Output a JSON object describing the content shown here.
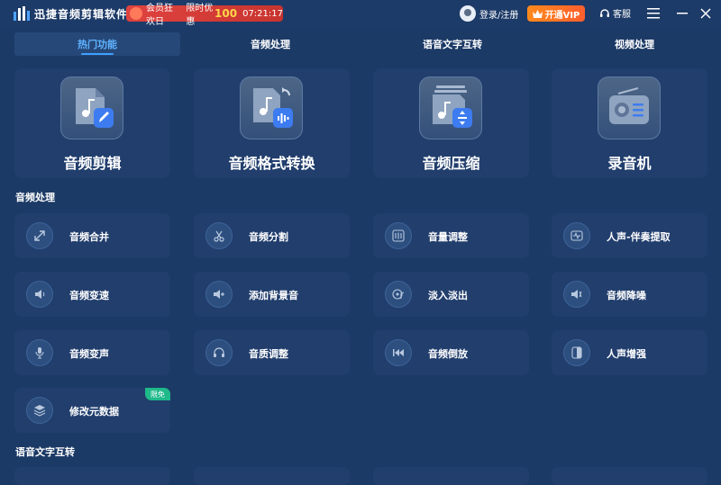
{
  "titlebar": {
    "app_name": "迅捷音频剪辑软件",
    "promo": {
      "tag": "会员狂欢日",
      "offer": "限时优惠",
      "number": "100",
      "countdown": "07:21:17"
    },
    "login_label": "登录/注册",
    "vip_label": "开通VIP",
    "service_label": "客服"
  },
  "tabs": [
    {
      "label": "热门功能",
      "active": true
    },
    {
      "label": "音频处理"
    },
    {
      "label": "语音文字互转"
    },
    {
      "label": "视频处理"
    }
  ],
  "features": [
    {
      "label": "音频剪辑",
      "icon": "music-edit-icon"
    },
    {
      "label": "音频格式转换",
      "icon": "music-convert-icon"
    },
    {
      "label": "音频压缩",
      "icon": "music-compress-icon"
    },
    {
      "label": "录音机",
      "icon": "radio-recorder-icon"
    }
  ],
  "sections": {
    "audio": "音频处理",
    "speech": "语音文字互转"
  },
  "items": [
    {
      "label": "音频合并",
      "icon": "merge-icon"
    },
    {
      "label": "音频分割",
      "icon": "scissors-icon"
    },
    {
      "label": "音量调整",
      "icon": "volume-adjust-icon"
    },
    {
      "label": "人声-伴奏提取",
      "icon": "waveform-icon"
    },
    {
      "label": "音频变速",
      "icon": "speed-icon"
    },
    {
      "label": "添加背景音",
      "icon": "add-background-icon"
    },
    {
      "label": "淡入淡出",
      "icon": "fade-icon"
    },
    {
      "label": "音频降噪",
      "icon": "denoise-icon"
    },
    {
      "label": "音频变声",
      "icon": "microphone-icon"
    },
    {
      "label": "音质调整",
      "icon": "headphones-icon"
    },
    {
      "label": "音频倒放",
      "icon": "rewind-icon"
    },
    {
      "label": "人声增强",
      "icon": "voice-enhance-icon"
    },
    {
      "label": "修改元数据",
      "icon": "layers-icon",
      "badge": "限免"
    }
  ],
  "colors": {
    "background": "#1c3a66",
    "card": "#213e6d",
    "accent": "#3ea0ff",
    "promo": "#e0433f",
    "vip": "#ff7a24",
    "badge": "#1fb98a"
  }
}
